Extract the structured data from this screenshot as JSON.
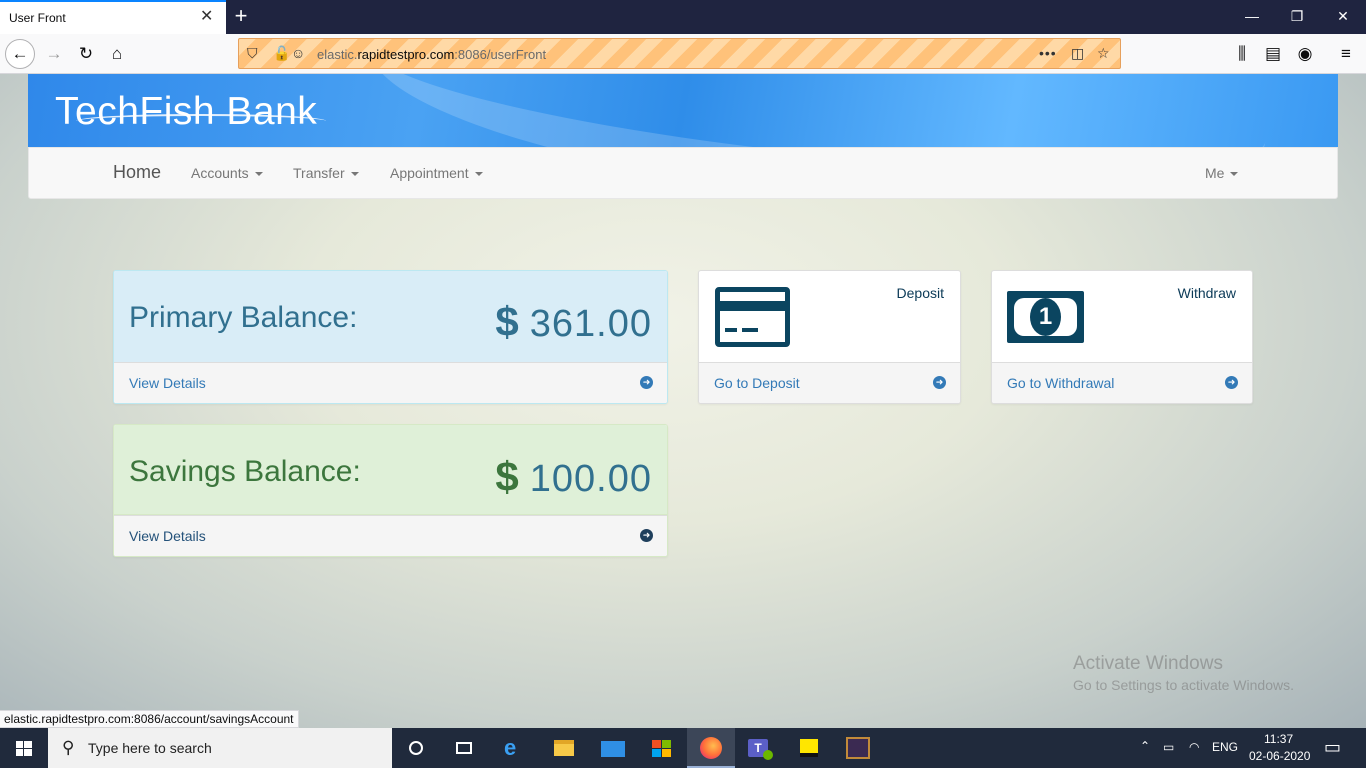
{
  "browser": {
    "tab_title": "User Front",
    "url_host_prefix": "elastic.",
    "url_host_main": "rapidtestpro.com",
    "url_rest": ":8086/userFront",
    "status_url": "elastic.rapidtestpro.com:8086/account/savingsAccount"
  },
  "site": {
    "brand": "TechFish Bank",
    "nav": {
      "home": "Home",
      "accounts": "Accounts",
      "transfer": "Transfer",
      "appointment": "Appointment",
      "me": "Me"
    }
  },
  "primary": {
    "label": "Primary Balance:",
    "currency": "$",
    "amount": "361.00",
    "link": "View Details"
  },
  "savings": {
    "label": "Savings Balance:",
    "currency": "$",
    "amount": "100.00",
    "link": "View Details"
  },
  "deposit": {
    "title": "Deposit",
    "link": "Go to Deposit",
    "icon": "credit-card-icon"
  },
  "withdraw": {
    "title": "Withdraw",
    "link": "Go to Withdrawal",
    "icon": "money-bill-icon"
  },
  "watermark": {
    "title": "Activate Windows",
    "subtitle": "Go to Settings to activate Windows."
  },
  "taskbar": {
    "search_placeholder": "Type here to search",
    "lang": "ENG",
    "time": "11:37",
    "date": "02-06-2020",
    "apps": [
      "task-view-icon",
      "edge-icon",
      "file-explorer-icon",
      "mail-icon",
      "store-icon",
      "firefox-icon",
      "teams-icon",
      "sticky-notes-icon",
      "app-icon"
    ]
  },
  "colors": {
    "primary_text": "#31708f",
    "savings_text": "#3c763d",
    "icon_dark": "#0b4560",
    "link": "#337ab7"
  }
}
